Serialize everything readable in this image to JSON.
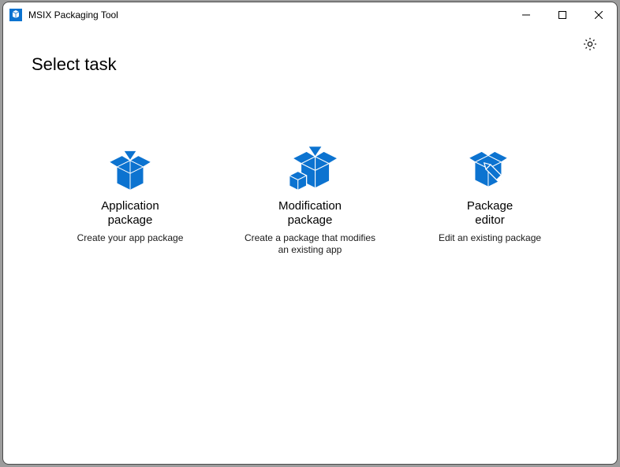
{
  "window": {
    "title": "MSIX Packaging Tool"
  },
  "header": {
    "page_title": "Select task"
  },
  "tiles": {
    "app": {
      "title": "Application\npackage",
      "desc": "Create your app package"
    },
    "mod": {
      "title": "Modification\npackage",
      "desc": "Create a package that modifies\nan existing app"
    },
    "editor": {
      "title": "Package\neditor",
      "desc": "Edit an existing package"
    }
  },
  "colors": {
    "brand": "#0c73d0"
  }
}
